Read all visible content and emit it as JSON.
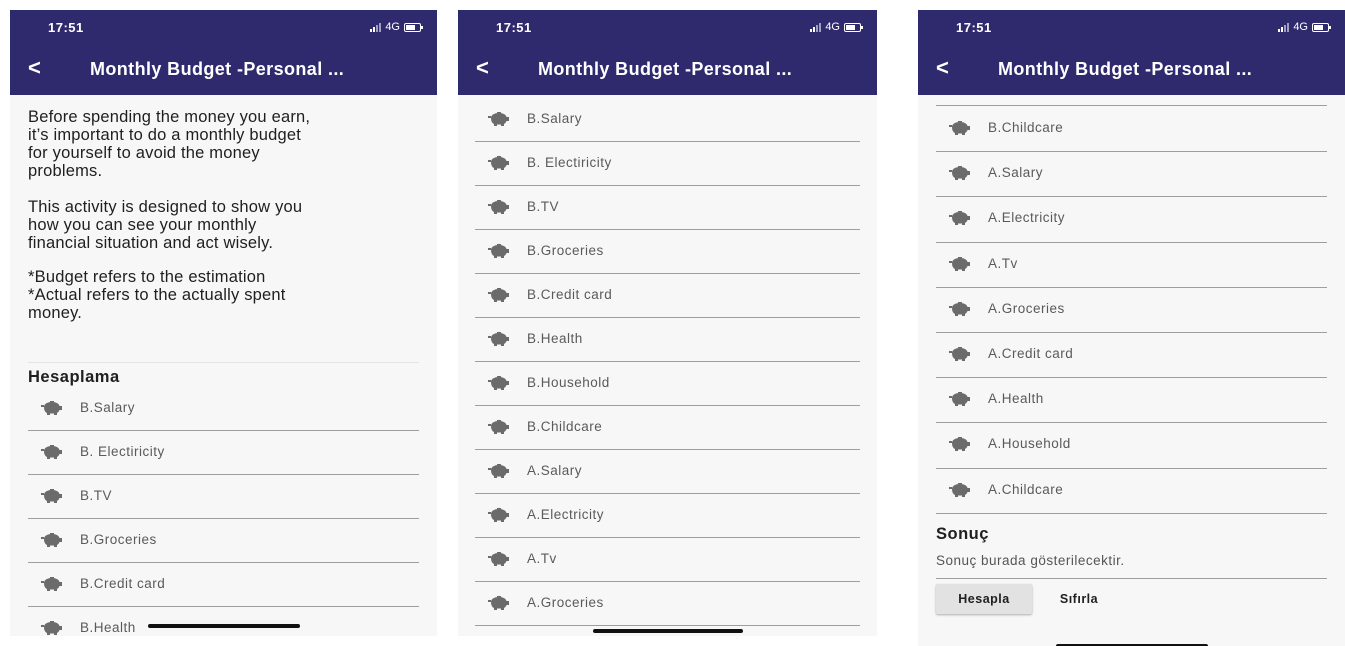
{
  "status": {
    "time": "17:51",
    "network": "4G"
  },
  "appbar": {
    "back_glyph": "<",
    "title": "Monthly Budget -Personal ..."
  },
  "intro": {
    "p1": [
      "Before spending the money you earn,",
      "it’s important to do a monthly budget",
      "for yourself to avoid the money",
      "problems."
    ],
    "p2": [
      "This activity is designed to show you",
      "how you can see your monthly",
      "financial situation and act wisely."
    ],
    "p3": [
      "*Budget refers to the estimation",
      "*Actual refers to the actually spent",
      "money."
    ]
  },
  "section_calc": "Hesaplama",
  "screen1_items": [
    "B.Salary",
    "B. Electiricity",
    "B.TV",
    "B.Groceries",
    "B.Credit card",
    "B.Health"
  ],
  "screen2_items": [
    "B.Salary",
    "B. Electiricity",
    "B.TV",
    "B.Groceries",
    "B.Credit card",
    "B.Health",
    "B.Household",
    "B.Childcare",
    "A.Salary",
    "A.Electricity",
    "A.Tv",
    "A.Groceries"
  ],
  "screen3_items": [
    "B.Childcare",
    "A.Salary",
    "A.Electricity",
    "A.Tv",
    "A.Groceries",
    "A.Credit card",
    "A.Health",
    "A.Household",
    "A.Childcare"
  ],
  "result": {
    "title": "Sonuç",
    "text": "Sonuç burada gösterilecektir."
  },
  "buttons": {
    "calculate": "Hesapla",
    "reset": "Sıfırla"
  },
  "icons": {
    "item_icon": "piggy-bank-icon",
    "back_icon": "back-arrow-icon"
  },
  "colors": {
    "header": "#2f2a6e",
    "background": "#f7f7f7",
    "divider": "#9e9e9e",
    "icon": "#6b6b6b"
  }
}
